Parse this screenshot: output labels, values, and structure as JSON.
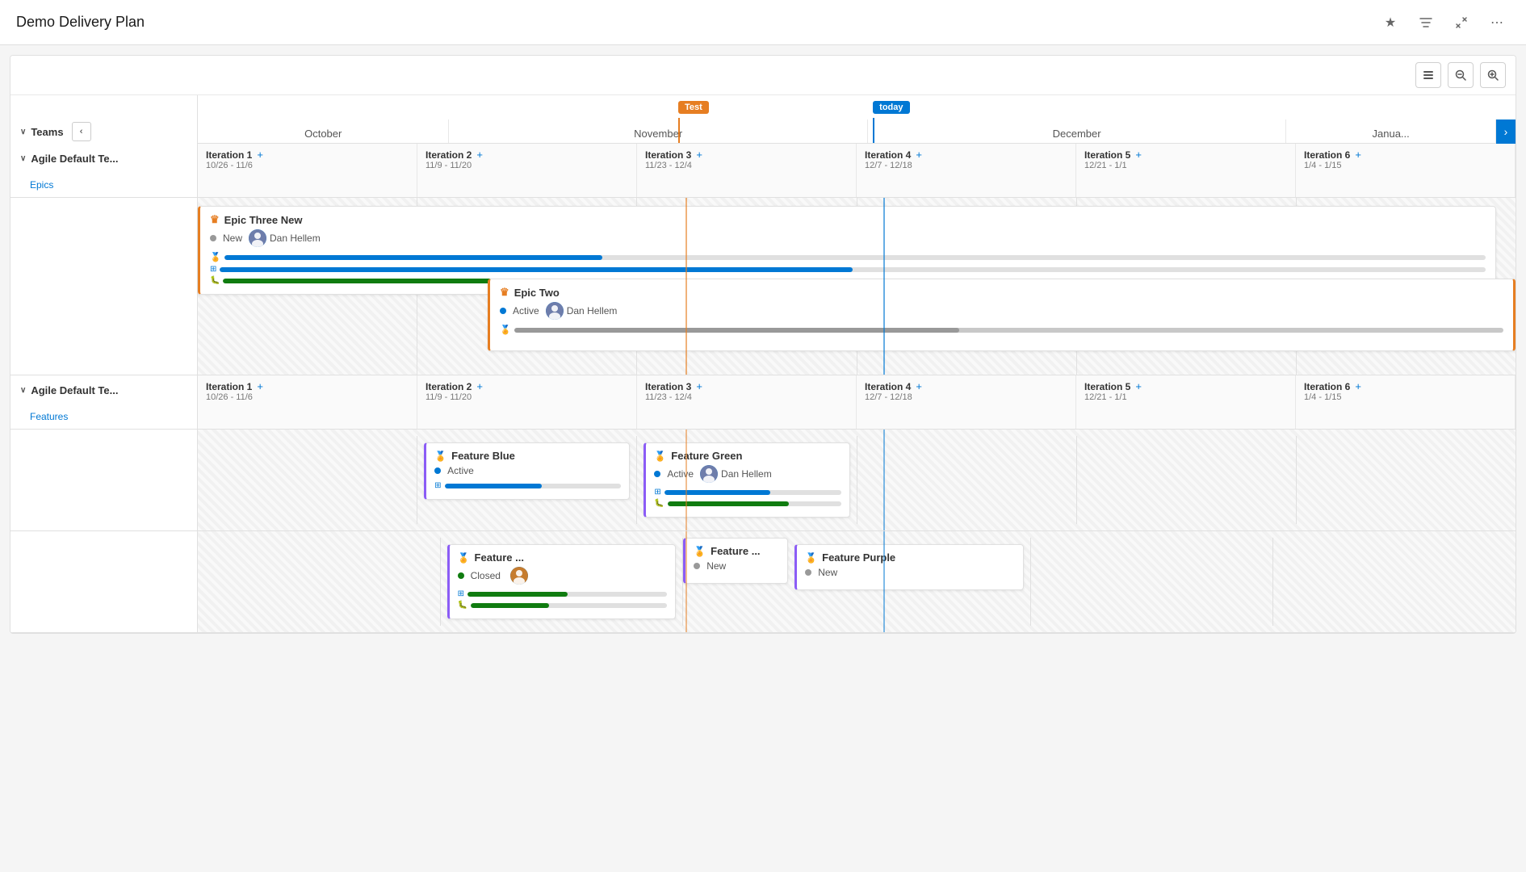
{
  "app": {
    "title": "Demo Delivery Plan"
  },
  "toolbar": {
    "collapse_label": "⊟",
    "zoom_out_label": "−",
    "zoom_in_label": "+"
  },
  "header": {
    "teams_label": "Teams",
    "nav_prev": "‹",
    "nav_next": "›",
    "months": [
      "October",
      "November",
      "December",
      "Janua..."
    ],
    "today_label": "today",
    "test_label": "Test"
  },
  "milestones": [
    {
      "label": "Test",
      "color": "#e67e22",
      "position": 38
    },
    {
      "label": "today",
      "color": "#0078d4",
      "position": 52
    }
  ],
  "team1": {
    "name": "Agile Default Te...",
    "backlog_label": "Epics",
    "iterations": [
      {
        "name": "Iteration 1",
        "dates": "10/26 - 11/6"
      },
      {
        "name": "Iteration 2",
        "dates": "11/9 - 11/20"
      },
      {
        "name": "Iteration 3",
        "dates": "11/23 - 12/4"
      },
      {
        "name": "Iteration 4",
        "dates": "12/7 - 12/18"
      },
      {
        "name": "Iteration 5",
        "dates": "12/21 - 1/1"
      },
      {
        "name": "Iteration 6",
        "dates": "1/4 - 1/15"
      }
    ],
    "epics": [
      {
        "title": "Epic Three New",
        "status": "New",
        "status_color": "gray",
        "assignee": "Dan Hellem",
        "bars": [
          {
            "type": "trophy",
            "fill": 30,
            "color": "blue"
          },
          {
            "type": "stack",
            "fill": 50,
            "color": "blue"
          },
          {
            "type": "bug",
            "fill": 65,
            "color": "green"
          }
        ]
      },
      {
        "title": "Epic Two",
        "status": "Active",
        "status_color": "blue",
        "assignee": "Dan Hellem",
        "bars": [
          {
            "type": "trophy",
            "fill": 45,
            "color": "gray"
          }
        ]
      }
    ]
  },
  "team2": {
    "name": "Agile Default Te...",
    "backlog_label": "Features",
    "iterations": [
      {
        "name": "Iteration 1",
        "dates": "10/26 - 11/6"
      },
      {
        "name": "Iteration 2",
        "dates": "11/9 - 11/20"
      },
      {
        "name": "Iteration 3",
        "dates": "11/23 - 12/4"
      },
      {
        "name": "Iteration 4",
        "dates": "12/7 - 12/18"
      },
      {
        "name": "Iteration 5",
        "dates": "12/21 - 1/1"
      },
      {
        "name": "Iteration 6",
        "dates": "1/4 - 1/15"
      }
    ],
    "features": {
      "row1": [
        {
          "col": 1,
          "title": "Feature Blue",
          "status": "Active",
          "status_color": "blue",
          "bars": [
            {
              "type": "stack",
              "fill": 55,
              "color": "blue"
            }
          ]
        },
        {
          "col": 2,
          "title": "Feature Green",
          "status": "Active",
          "status_color": "blue",
          "assignee": "Dan Hellem",
          "bars": [
            {
              "type": "stack",
              "fill": 60,
              "color": "blue"
            },
            {
              "type": "bug",
              "fill": 70,
              "color": "green"
            }
          ]
        }
      ],
      "row2": [
        {
          "col": 1,
          "title": "Feature ...",
          "status": "Closed",
          "status_color": "green",
          "has_avatar": true,
          "bars": [
            {
              "type": "stack",
              "fill": 50,
              "color": "green"
            },
            {
              "type": "bug",
              "fill": 40,
              "color": "green"
            }
          ]
        },
        {
          "col": 2,
          "title": "Feature ...",
          "status": "New",
          "status_color": "gray",
          "bars": []
        },
        {
          "col": 3,
          "title": "Feature Purple",
          "status": "New",
          "status_color": "gray",
          "bars": []
        }
      ]
    }
  },
  "icons": {
    "star": "★",
    "filter": "⊟",
    "collapse": "⤡",
    "more": "⋯",
    "chevron_down": "∨",
    "chevron_right": "›",
    "chevron_left": "‹",
    "crown": "♛",
    "trophy": "🏆",
    "trophy_small": "🏅",
    "stack": "📋",
    "bug": "🐛",
    "plus": "+"
  },
  "colors": {
    "accent_blue": "#0078d4",
    "accent_orange": "#e67e22",
    "accent_purple": "#8b5cf6",
    "accent_green": "#107c10",
    "today_blue": "#0078d4"
  }
}
